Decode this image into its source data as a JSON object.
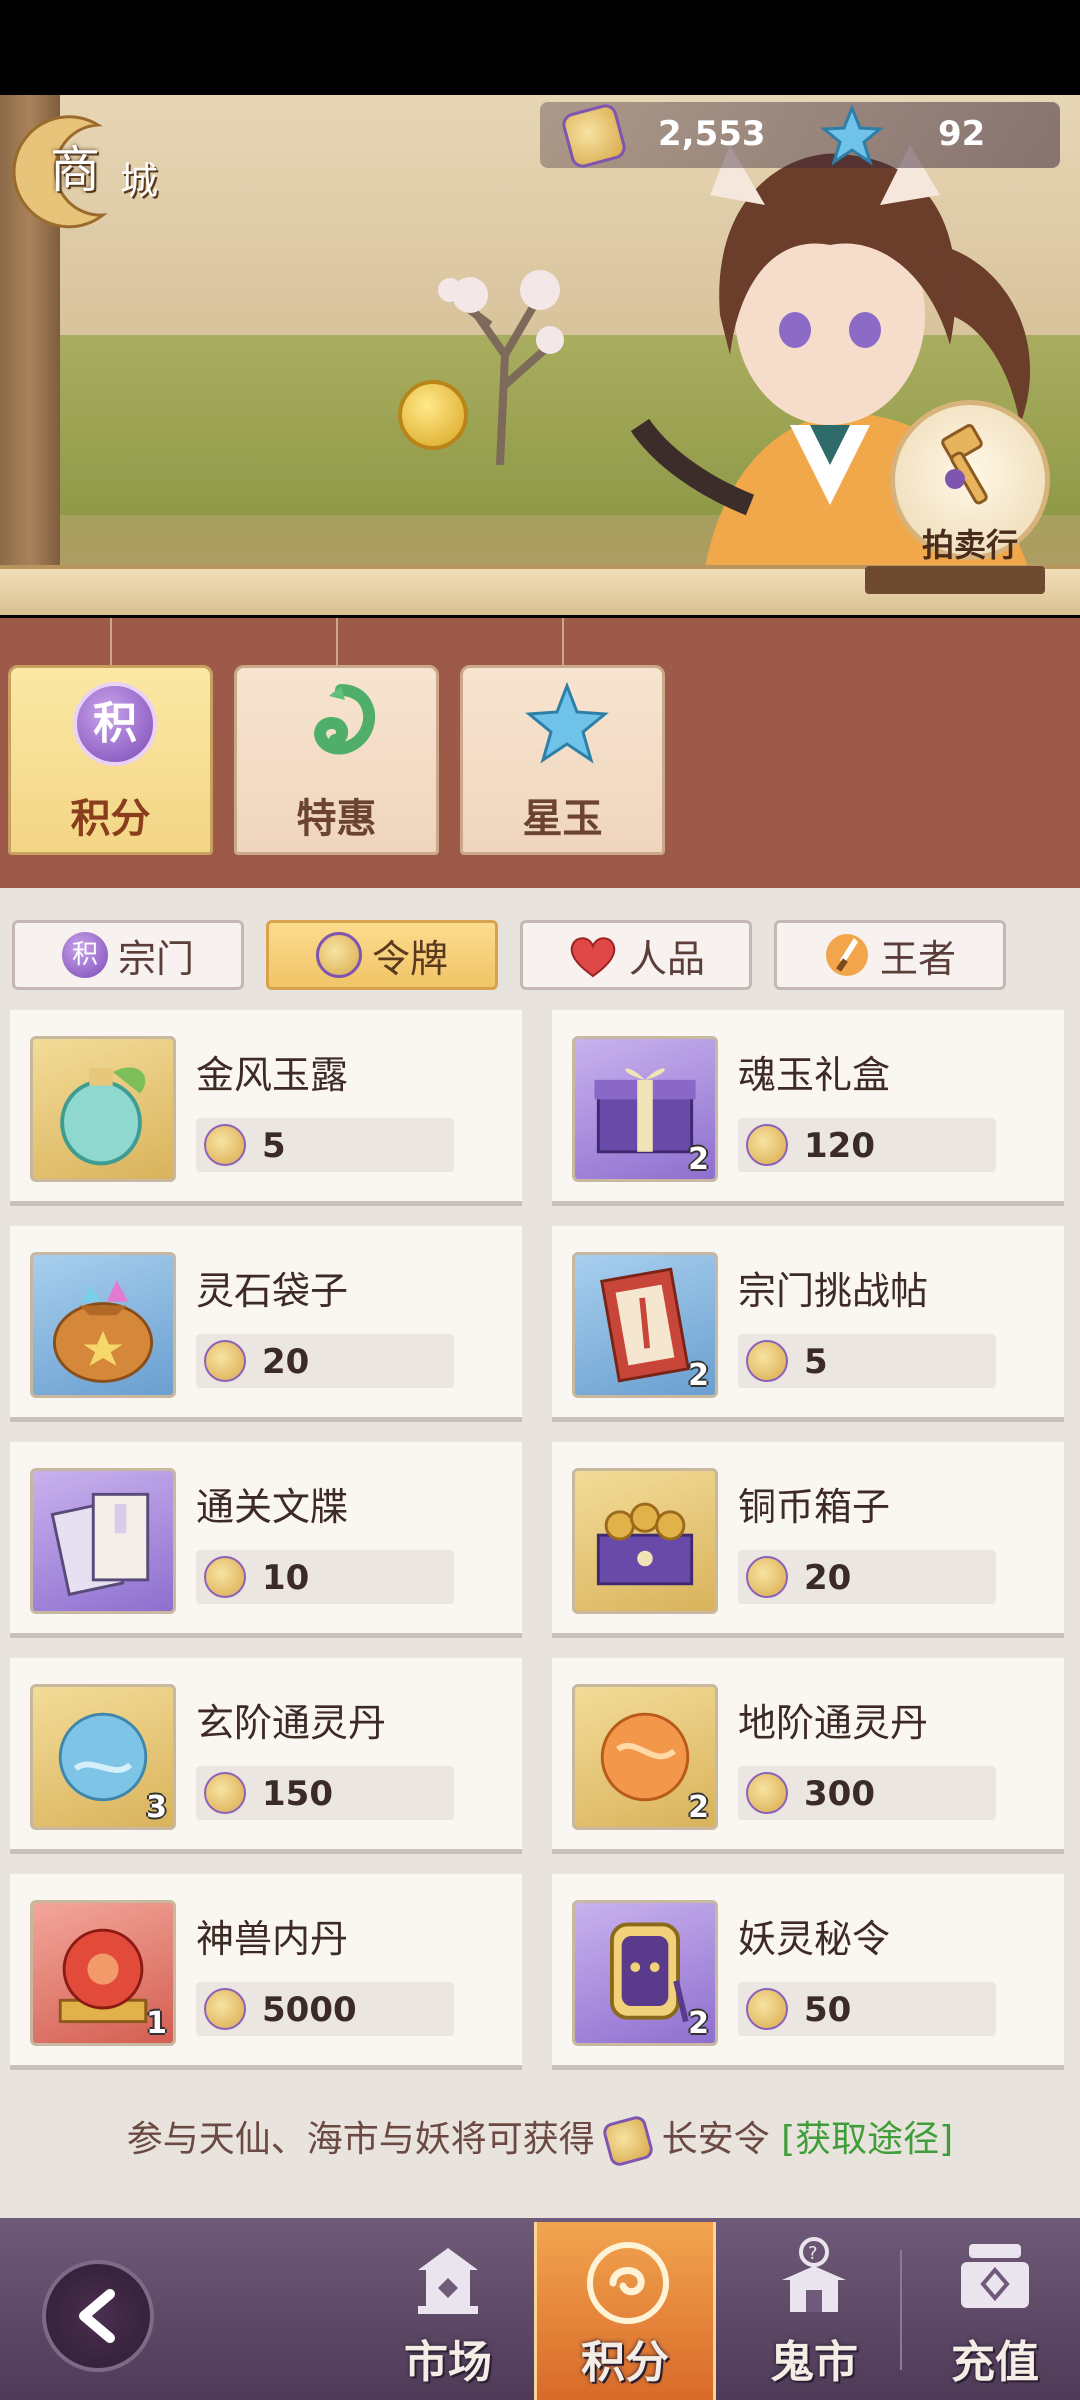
{
  "header": {
    "title_big": "商",
    "title_small": "城",
    "currency_1": "2,553",
    "currency_2": "92",
    "auction_label": "拍卖行"
  },
  "categories": [
    {
      "label": "积分",
      "icon_glyph": "积",
      "icon": "points-icon",
      "active": true
    },
    {
      "label": "特惠",
      "icon": "jade-dragon-icon",
      "active": false
    },
    {
      "label": "星玉",
      "icon": "star-jade-icon",
      "active": false
    }
  ],
  "sub_tabs": [
    {
      "label": "宗门",
      "icon_glyph": "积",
      "icon": "sect-icon",
      "active": false
    },
    {
      "label": "令牌",
      "icon": "token-icon",
      "active": true
    },
    {
      "label": "人品",
      "icon": "heart-icon",
      "active": false
    },
    {
      "label": "王者",
      "icon": "sword-icon",
      "active": false
    }
  ],
  "items": [
    {
      "name": "金风玉露",
      "price": "5",
      "qty": "",
      "frame": "gold",
      "icon": "elixir-bottle-icon"
    },
    {
      "name": "魂玉礼盒",
      "price": "120",
      "qty": "2",
      "frame": "purple",
      "icon": "gift-box-icon"
    },
    {
      "name": "灵石袋子",
      "price": "20",
      "qty": "",
      "frame": "blue",
      "icon": "stone-bag-icon"
    },
    {
      "name": "宗门挑战帖",
      "price": "5",
      "qty": "2",
      "frame": "blue",
      "icon": "challenge-letter-icon"
    },
    {
      "name": "通关文牒",
      "price": "10",
      "qty": "",
      "frame": "purple",
      "icon": "pass-document-icon"
    },
    {
      "name": "铜币箱子",
      "price": "20",
      "qty": "",
      "frame": "gold",
      "icon": "coin-chest-icon"
    },
    {
      "name": "玄阶通灵丹",
      "price": "150",
      "qty": "3",
      "frame": "gold",
      "icon": "blue-pill-icon"
    },
    {
      "name": "地阶通灵丹",
      "price": "300",
      "qty": "2",
      "frame": "gold",
      "icon": "orange-pill-icon"
    },
    {
      "name": "神兽内丹",
      "price": "5000",
      "qty": "1",
      "frame": "red",
      "icon": "beast-core-icon"
    },
    {
      "name": "妖灵秘令",
      "price": "50",
      "qty": "2",
      "frame": "purple",
      "icon": "demon-token-icon"
    }
  ],
  "note": {
    "prefix": "参与天仙、海市与妖将可获得",
    "suffix": "长安令",
    "link": "[获取途径]"
  },
  "nav": [
    {
      "label": "市场",
      "icon": "market-icon",
      "active": false
    },
    {
      "label": "积分",
      "icon": "points-nav-icon",
      "active": true
    },
    {
      "label": "鬼市",
      "icon": "ghost-market-icon",
      "active": false
    },
    {
      "label": "充值",
      "icon": "recharge-icon",
      "active": false
    }
  ],
  "colors": {
    "accent": "#f1c467",
    "board": "#9e5a48",
    "link": "#3f9e3a"
  }
}
